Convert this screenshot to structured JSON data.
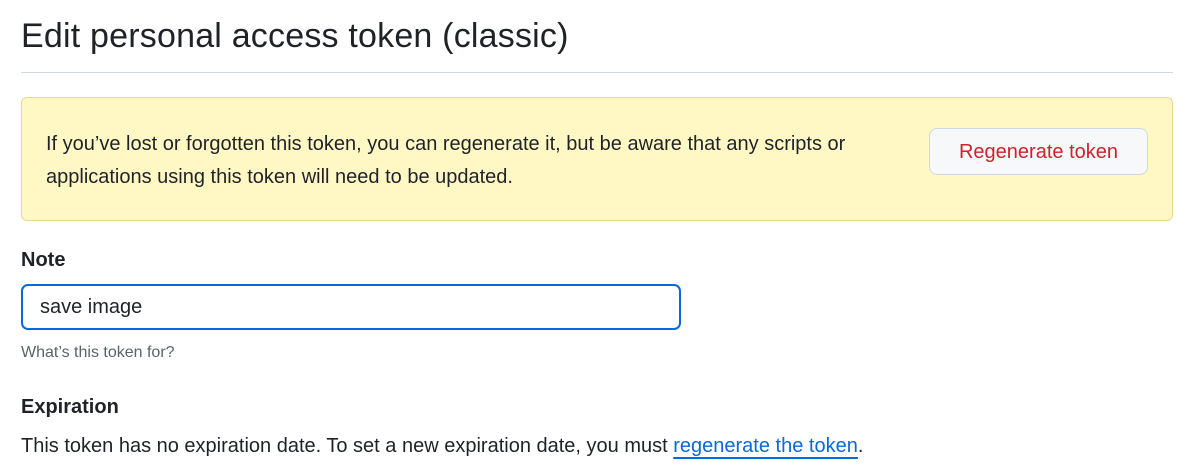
{
  "page": {
    "title": "Edit personal access token (classic)"
  },
  "flash": {
    "message": "If you’ve lost or forgotten this token, you can regenerate it, but be aware that any scripts or applications using this token will need to be updated.",
    "button_label": "Regenerate token"
  },
  "note": {
    "label": "Note",
    "value": "save image",
    "hint": "What’s this token for?"
  },
  "expiration": {
    "label": "Expiration",
    "text_before_link": "This token has no expiration date. To set a new expiration date, you must ",
    "link_text": "regenerate the token",
    "text_after_link": "."
  },
  "colors": {
    "flash_background": "#fff8c5",
    "danger_text": "#cf222e",
    "focus_border": "#0969da",
    "link": "#0969da"
  }
}
